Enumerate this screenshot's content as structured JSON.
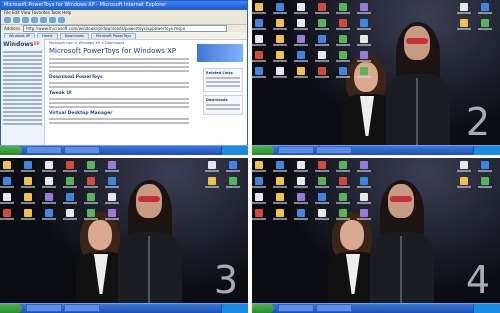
{
  "quadrants": [
    {
      "id": 1,
      "window": {
        "title": "Microsoft PowerToys for Windows XP - Microsoft Internet Explorer",
        "menu": "File  Edit  View  Favorites  Tools  Help",
        "address_label": "Address",
        "address": "http://www.microsoft.com/windowsxp/downloads/powertoys/xppowertoys.mspx",
        "tabs": [
          "Windows XP",
          "Home",
          "Downloads",
          "Microsoft PowerToys"
        ],
        "logo": "Windows",
        "logo_sup": "XP",
        "breadcrumb": "Microsoft.com > Windows XP > Downloads",
        "page_title": "Microsoft PowerToys for Windows XP",
        "sections": [
          "Download PowerToys",
          "Tweak UI",
          "Virtual Desktop Manager"
        ],
        "sidebar_boxes": [
          "Related Links",
          "Downloads"
        ]
      }
    },
    {
      "id": 2,
      "number": "2"
    },
    {
      "id": 3,
      "number": "3"
    },
    {
      "id": 4,
      "number": "4"
    }
  ],
  "icon_colors": [
    "#f0c24a",
    "#3f86e0",
    "#e8e8e8",
    "#d24a3a",
    "#58b458",
    "#9a7ad8"
  ]
}
